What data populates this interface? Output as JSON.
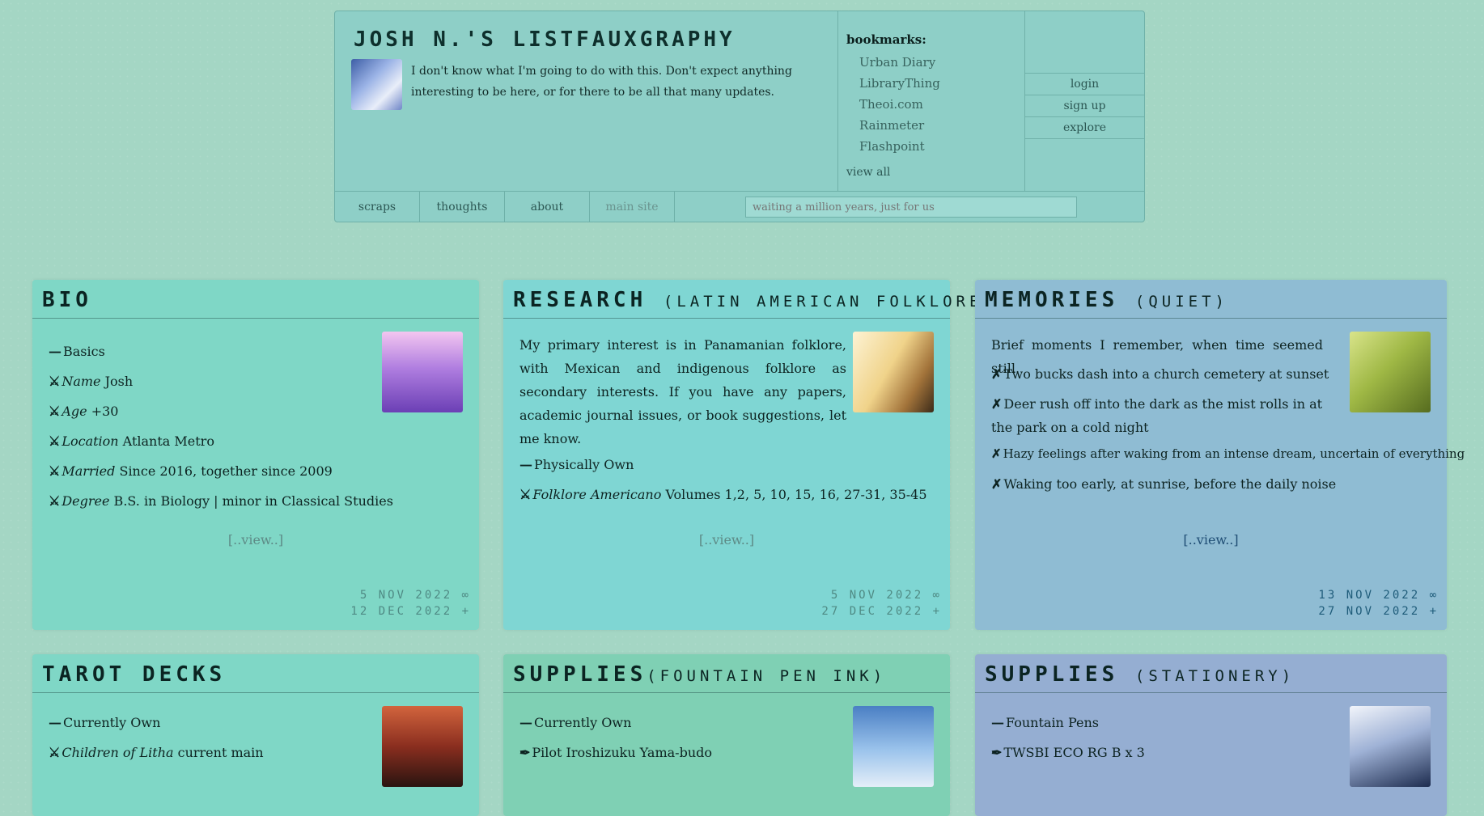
{
  "header": {
    "title": "Josh N.'s Listfauxgraphy",
    "description": "I don't know what I'm going to do with this. Don't expect anything interesting to be here, or for there to be all that many updates.",
    "bookmarks_title": "bookmarks:",
    "bookmarks": [
      "Urban Diary",
      "LibraryThing",
      "Theoi.com",
      "Rainmeter",
      "Flashpoint"
    ],
    "view_all": "view all",
    "account": [
      "login",
      "sign up",
      "explore"
    ],
    "nav": [
      "scraps",
      "thoughts",
      "about",
      "main site"
    ],
    "search_placeholder": "waiting a million years, just for us"
  },
  "cards": {
    "bio": {
      "title": "BIO",
      "items": [
        {
          "marker": "—",
          "label": "",
          "text": "Basics"
        },
        {
          "marker": "⚔",
          "label": "Name",
          "text": " Josh"
        },
        {
          "marker": "⚔",
          "label": "Age",
          "text": " +30"
        },
        {
          "marker": "⚔",
          "label": "Location",
          "text": " Atlanta Metro"
        },
        {
          "marker": "⚔",
          "label": "Married",
          "text": " Since 2016, together since 2009"
        },
        {
          "marker": "⚔",
          "label": "Degree",
          "text": " B.S. in Biology | minor in Classical Studies"
        }
      ],
      "view": "[..view..]",
      "date_created": "5 NOV 2022 ∞",
      "date_updated": "12 DEC 2022 +"
    },
    "research": {
      "title": "RESEARCH",
      "subtitle": "(LATIN AMERICAN FOLKLORE)",
      "paragraph": "My primary interest is in Panamanian folklore, with Mexican and indigenous folklore as secondary interests. If you have any papers, academic journal issues, or book suggestions, let me know.",
      "items": [
        {
          "marker": "—",
          "label": "",
          "text": "Physically Own"
        },
        {
          "marker": "⚔",
          "label": "Folklore Americano",
          "text": " Volumes 1,2, 5, 10, 15, 16, 27-31, 35-45"
        }
      ],
      "view": "[..view..]",
      "date_created": "5 NOV 2022 ∞",
      "date_updated": "27 DEC 2022 +"
    },
    "memories": {
      "title": "MEMORIES",
      "subtitle": "(QUIET)",
      "intro": "Brief moments I remember, when time seemed still.",
      "items": [
        "Two bucks dash into a church cemetery at sunset",
        "Deer rush off into the dark as the mist rolls in at the park on a cold night",
        "Hazy feelings after waking from an intense dream, uncertain of everything",
        "Waking too early, at sunrise, before the daily noise"
      ],
      "view": "[..view..]",
      "date_created": "13 NOV 2022 ∞",
      "date_updated": "27 NOV 2022 +"
    },
    "tarot": {
      "title": "TAROT DECKS",
      "items": [
        {
          "marker": "—",
          "label": "",
          "text": "Currently Own"
        },
        {
          "marker": "⚔",
          "label": "Children of Litha",
          "text": " current main"
        }
      ]
    },
    "ink": {
      "title": "SUPPLIES",
      "subtitle": "(FOUNTAIN PEN INK)",
      "items": [
        {
          "marker": "—",
          "label": "",
          "text": "Currently Own"
        },
        {
          "marker": "✒",
          "label": "",
          "text": "Pilot Iroshizuku Yama-budo"
        }
      ]
    },
    "stationery": {
      "title": "SUPPLIES",
      "subtitle": "(STATIONERY)",
      "items": [
        {
          "marker": "—",
          "label": "",
          "text": "Fountain Pens"
        },
        {
          "marker": "✒",
          "label": "",
          "text": "TWSBI ECO RG B x 3"
        }
      ]
    }
  },
  "colors": {
    "background": "#a4d6c4",
    "header": "#8ecfc7",
    "bio": "#7fd7c6",
    "research": "#7fd6d3",
    "memories": "#8fbcd3",
    "tarot": "#7fd7c6",
    "ink": "#7fd0b4",
    "stationery": "#95aed2"
  }
}
